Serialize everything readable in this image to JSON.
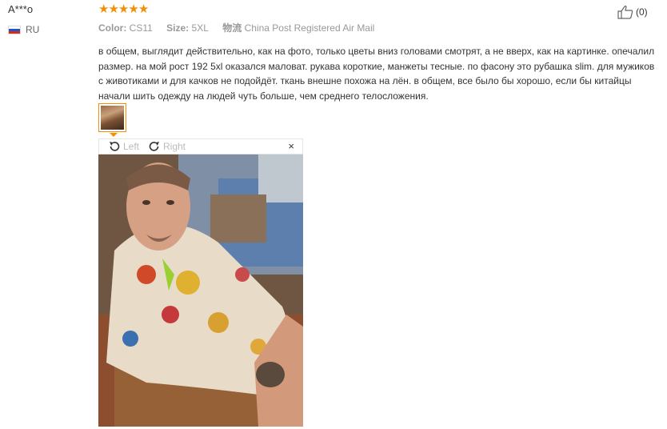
{
  "reviewer": {
    "name": "A***o",
    "country_code": "RU"
  },
  "rating": {
    "stars": 5,
    "max": 5,
    "color": "#f38e05"
  },
  "meta": {
    "color_label": "Color:",
    "color_value": "CS11",
    "size_label": "Size:",
    "size_value": "5XL",
    "shipping_label": "物流",
    "shipping_value": "China Post Registered Air Mail"
  },
  "feedback": {
    "text": "в общем, выглядит действительно, как на фото, только цветы вниз головами смотрят, а не вверх, как на картинке. опечалил размер. на мой рост 192 5xl оказался маловат. рукава короткие, манжеты тесные. по фасону это рубашка slim. для мужиков с животиками и для качков не подойдёт. ткань внешне похожа на лён. в общем, все было бы хорошо, если бы китайцы начали шить одежду на людей чуть больше, чем среднего телосложения."
  },
  "helpful": {
    "count": "(0)",
    "icon": "thumbs-up-icon"
  },
  "viewer": {
    "left_label": "Left",
    "right_label": "Right",
    "close_label": "×"
  }
}
